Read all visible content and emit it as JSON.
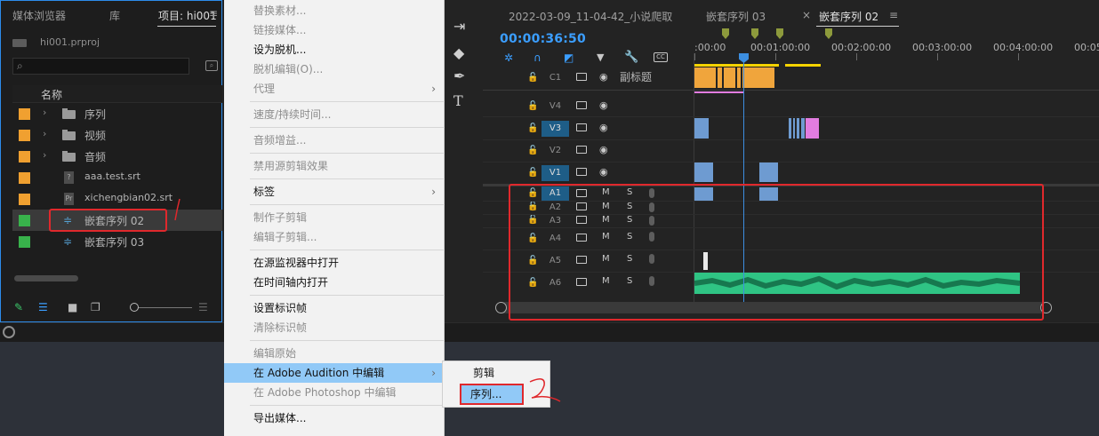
{
  "project": {
    "tabs": [
      "媒体浏览器",
      "库",
      "项目: hi001"
    ],
    "menu_icon": "hamburger-icon",
    "project_file": "hi001.prproj",
    "column_name": "名称",
    "items": [
      {
        "name": "序列",
        "type": "folder",
        "color": "#f0a030"
      },
      {
        "name": "视频",
        "type": "folder",
        "color": "#f0a030"
      },
      {
        "name": "音频",
        "type": "folder",
        "color": "#f0a030"
      },
      {
        "name": "aaa.test.srt",
        "type": "file",
        "file_badge": "?",
        "color": "#f0a030"
      },
      {
        "name": "xichengbian02.srt",
        "type": "file",
        "file_badge": "Pr",
        "color": "#f0a030"
      },
      {
        "name": "嵌套序列 02",
        "type": "sequence",
        "color": "#38b24b"
      },
      {
        "name": "嵌套序列 03",
        "type": "sequence",
        "color": "#38b24b"
      }
    ]
  },
  "context_menu": {
    "items": [
      {
        "label": "替换素材...",
        "disabled": true
      },
      {
        "label": "链接媒体...",
        "disabled": true
      },
      {
        "label": "设为脱机...",
        "disabled": false
      },
      {
        "label": "脱机编辑(O)...",
        "disabled": true
      },
      {
        "label": "代理",
        "disabled": true,
        "submenu": true
      },
      {
        "label": "速度/持续时间...",
        "disabled": true
      },
      {
        "label": "音频增益...",
        "disabled": true
      },
      {
        "label": "禁用源剪辑效果",
        "disabled": true
      },
      {
        "label": "标签",
        "disabled": false,
        "submenu": true
      },
      {
        "label": "制作子剪辑",
        "disabled": true
      },
      {
        "label": "编辑子剪辑...",
        "disabled": true
      },
      {
        "label": "在源监视器中打开",
        "disabled": false
      },
      {
        "label": "在时间轴内打开",
        "disabled": false
      },
      {
        "label": "设置标识帧",
        "disabled": false
      },
      {
        "label": "清除标识帧",
        "disabled": true
      },
      {
        "label": "编辑原始",
        "disabled": true
      },
      {
        "label": "在 Adobe Audition 中编辑",
        "disabled": false,
        "submenu": true,
        "active": true
      },
      {
        "label": "在 Adobe Photoshop 中编辑",
        "disabled": true
      },
      {
        "label": "导出媒体...",
        "disabled": false
      }
    ],
    "submenu_arrow": "›"
  },
  "submenu": {
    "items": [
      "剪辑",
      "序列..."
    ]
  },
  "tools": [
    "ripple-edit-icon",
    "razor-icon",
    "pen-icon",
    "type-icon"
  ],
  "timeline": {
    "tabs": [
      "2022-03-09_11-04-42_小说爬取",
      "嵌套序列 03",
      "嵌套序列 02"
    ],
    "close_glyph": "×",
    "menu_glyph": "≡",
    "timecode": "00:00:36:50",
    "ruler_labels": [
      ":00:00",
      "00:01:00:00",
      "00:02:00:00",
      "00:03:00:00",
      "00:04:00:00",
      "00:05"
    ],
    "tracks": [
      {
        "name": "C1",
        "subtitle": "副标题",
        "kind": "caption"
      },
      {
        "name": "V4",
        "kind": "video",
        "on": false
      },
      {
        "name": "V3",
        "kind": "video",
        "on": true
      },
      {
        "name": "V2",
        "kind": "video",
        "on": false
      },
      {
        "name": "V1",
        "kind": "video",
        "on": true
      },
      {
        "name": "A1",
        "kind": "audio",
        "on": true
      },
      {
        "name": "A2",
        "kind": "audio",
        "on": false
      },
      {
        "name": "A3",
        "kind": "audio",
        "on": false
      },
      {
        "name": "A4",
        "kind": "audio",
        "on": false
      },
      {
        "name": "A5",
        "kind": "audio",
        "on": false
      },
      {
        "name": "A6",
        "kind": "audio",
        "on": false
      }
    ],
    "mute_label": "M",
    "solo_label": "S",
    "colors": {
      "caption_clip": "#f0a53c",
      "video_clip": "#6e9bd1",
      "pink_clip": "#e27ce0",
      "audio_clip": "#2fc484",
      "accent": "#2d8ceb",
      "annotation": "#e0282c"
    }
  }
}
